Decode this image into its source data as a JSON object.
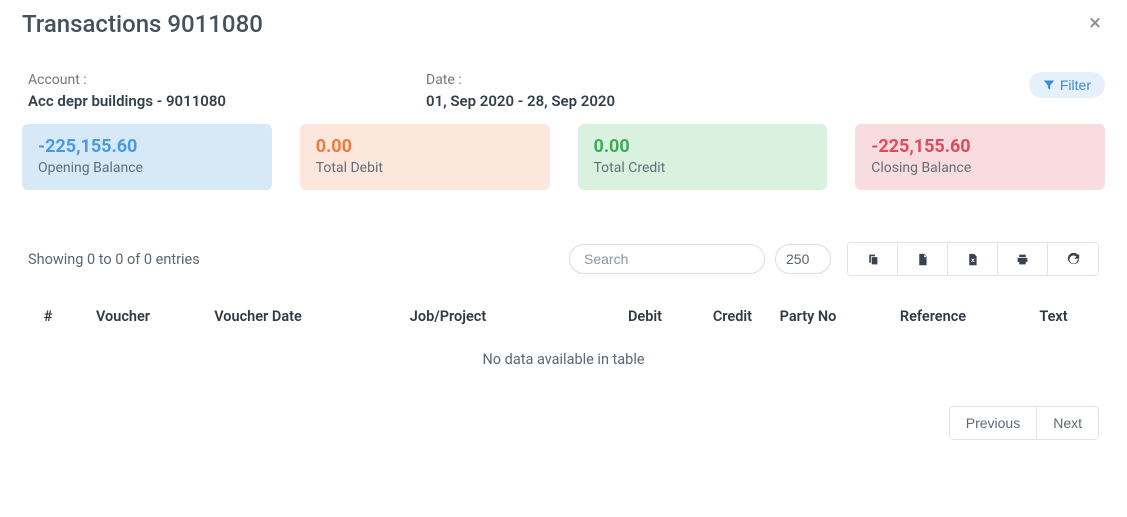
{
  "header": {
    "title": "Transactions 9011080"
  },
  "meta": {
    "account_label": "Account :",
    "account_value": "Acc depr buildings - 9011080",
    "date_label": "Date :",
    "date_value": "01, Sep 2020 - 28, Sep 2020"
  },
  "filter": {
    "label": "Filter"
  },
  "cards": {
    "opening": {
      "value": "-225,155.60",
      "label": "Opening Balance"
    },
    "debit": {
      "value": "0.00",
      "label": "Total Debit"
    },
    "credit": {
      "value": "0.00",
      "label": "Total Credit"
    },
    "closing": {
      "value": "-225,155.60",
      "label": "Closing Balance"
    }
  },
  "tools": {
    "showing_text": "Showing 0 to 0 of 0 entries",
    "search_placeholder": "Search",
    "page_size_value": "250"
  },
  "columns": {
    "c0": "#",
    "c1": "Voucher",
    "c2": "Voucher Date",
    "c3": "Job/Project",
    "c4": "Debit",
    "c5": "Credit",
    "c6": "Party No",
    "c7": "Reference",
    "c8": "Text"
  },
  "empty_text": "No data available in table",
  "pager": {
    "prev": "Previous",
    "next": "Next"
  }
}
